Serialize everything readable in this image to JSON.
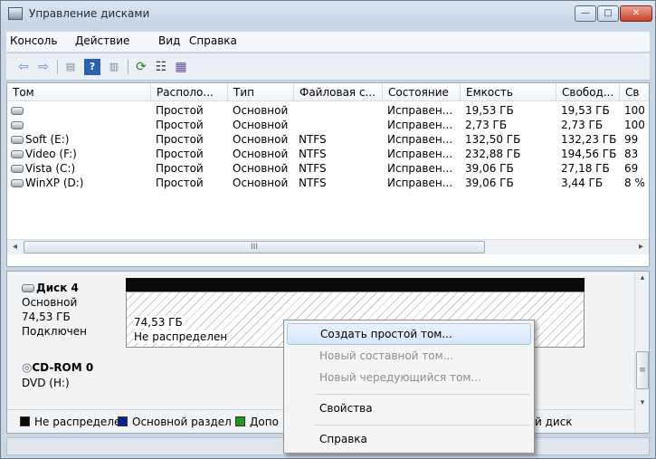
{
  "window": {
    "title": "Управление дисками"
  },
  "menu": [
    "Консоль",
    "Действие",
    "Вид",
    "Справка"
  ],
  "volume_table": {
    "columns": [
      "Том",
      "Располо...",
      "Тип",
      "Файловая с...",
      "Состояние",
      "Емкость",
      "Свобод...",
      "Св"
    ],
    "rows": [
      [
        "",
        "Простой",
        "Основной",
        "",
        "Исправен...",
        "19,53 ГБ",
        "19,53 ГБ",
        "100"
      ],
      [
        "",
        "Простой",
        "Основной",
        "",
        "Исправен...",
        "2,73 ГБ",
        "2,73 ГБ",
        "100"
      ],
      [
        "Soft (E:)",
        "Простой",
        "Основной",
        "NTFS",
        "Исправен...",
        "132,50 ГБ",
        "132,23 ГБ",
        "99"
      ],
      [
        "Video (F:)",
        "Простой",
        "Основной",
        "NTFS",
        "Исправен...",
        "232,88 ГБ",
        "194,56 ГБ",
        "83"
      ],
      [
        "Vista (C:)",
        "Простой",
        "Основной",
        "NTFS",
        "Исправен...",
        "39,06 ГБ",
        "27,18 ГБ",
        "69"
      ],
      [
        "WinXP (D:)",
        "Простой",
        "Основной",
        "NTFS",
        "Исправен...",
        "39,06 ГБ",
        "3,44 ГБ",
        "8 %"
      ]
    ],
    "hscroll_grip": "III"
  },
  "disks": {
    "disk4": {
      "name": "Диск 4",
      "kind": "Основной",
      "size": "74,53 ГБ",
      "state": "Подключен",
      "partition_size": "74,53 ГБ",
      "partition_state": "Не распределен"
    },
    "cdrom": {
      "name": "CD-ROM 0",
      "kind": "DVD (H:)"
    }
  },
  "legend": [
    {
      "label": "Не распределен",
      "color": "#0a0a0a"
    },
    {
      "label": "Основной раздел",
      "color": "#0a1f8f"
    },
    {
      "label": "Допо",
      "color": "#1f9a1f"
    }
  ],
  "legend_tail": "й диск",
  "context_menu": [
    {
      "label": "Создать простой том...",
      "state": "highlighted"
    },
    {
      "label": "Новый составной том...",
      "state": "disabled"
    },
    {
      "label": "Новый чередующийся том...",
      "state": "disabled"
    },
    {
      "label": "Свойства",
      "state": "enabled"
    },
    {
      "label": "Справка",
      "state": "enabled"
    }
  ],
  "colors": {
    "accent": "#c9d6e4",
    "selection": "#d6e7fb"
  },
  "icons": [
    "back-arrow-icon",
    "forward-arrow-icon",
    "console-tree-icon",
    "help-icon",
    "action-pane-icon",
    "refresh-icon",
    "properties-icon",
    "export-icon"
  ]
}
